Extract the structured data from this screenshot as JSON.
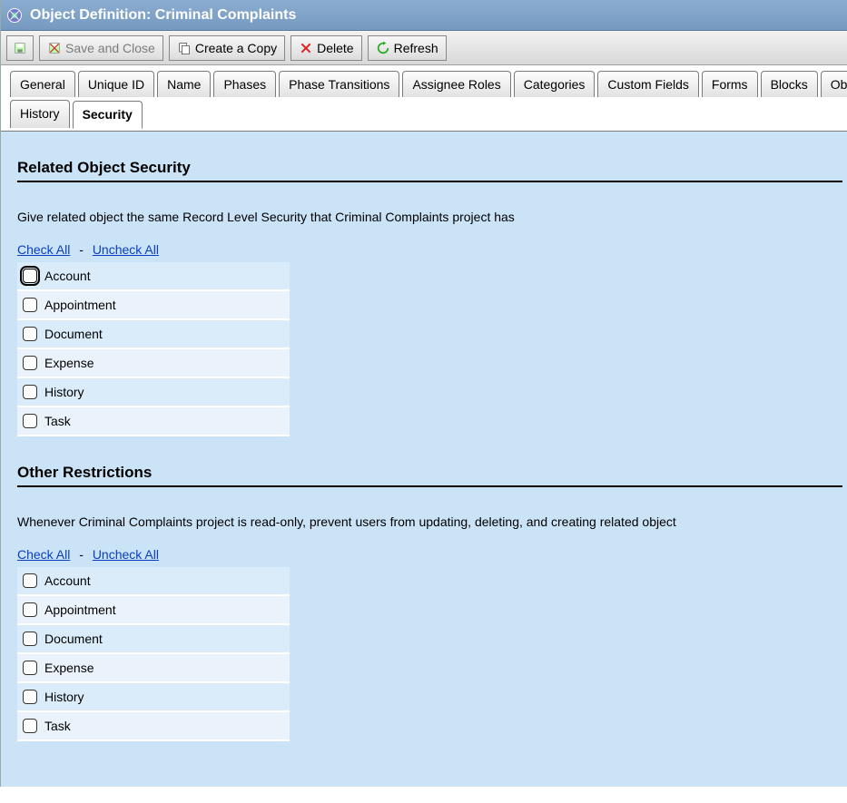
{
  "titlebar": {
    "text": "Object Definition: Criminal Complaints"
  },
  "toolbar": {
    "save_close": "Save and Close",
    "create_copy": "Create a Copy",
    "delete": "Delete",
    "refresh": "Refresh"
  },
  "tabs_row1": [
    {
      "key": "general",
      "label": "General"
    },
    {
      "key": "unique-id",
      "label": "Unique ID"
    },
    {
      "key": "name",
      "label": "Name"
    },
    {
      "key": "phases",
      "label": "Phases"
    },
    {
      "key": "phase-transitions",
      "label": "Phase Transitions"
    },
    {
      "key": "assignee-roles",
      "label": "Assignee Roles"
    },
    {
      "key": "categories",
      "label": "Categories"
    },
    {
      "key": "custom-fields",
      "label": "Custom Fields"
    },
    {
      "key": "forms",
      "label": "Forms"
    },
    {
      "key": "blocks",
      "label": "Blocks"
    },
    {
      "key": "object-views",
      "label": "Object Views"
    }
  ],
  "tabs_row2": [
    {
      "key": "history",
      "label": "History"
    },
    {
      "key": "security",
      "label": "Security",
      "active": true
    }
  ],
  "section1": {
    "title": "Related Object Security",
    "desc": "Give related object the same Record Level Security that Criminal Complaints project has",
    "check_all": "Check All",
    "uncheck_all": "Uncheck All",
    "items": [
      {
        "label": "Account",
        "focused": true
      },
      {
        "label": "Appointment"
      },
      {
        "label": "Document"
      },
      {
        "label": "Expense"
      },
      {
        "label": "History"
      },
      {
        "label": "Task"
      }
    ]
  },
  "section2": {
    "title": "Other Restrictions",
    "desc": "Whenever Criminal Complaints project is read-only, prevent users from updating, deleting, and creating related object",
    "check_all": "Check All",
    "uncheck_all": "Uncheck All",
    "items": [
      {
        "label": "Account"
      },
      {
        "label": "Appointment"
      },
      {
        "label": "Document"
      },
      {
        "label": "Expense"
      },
      {
        "label": "History"
      },
      {
        "label": "Task"
      }
    ]
  }
}
